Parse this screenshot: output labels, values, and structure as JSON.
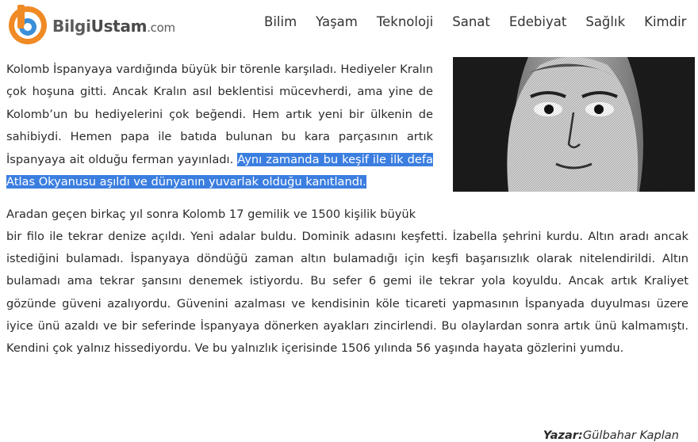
{
  "brand": {
    "part1": "Bilgi",
    "part2": "Ustam",
    "part3": ".com"
  },
  "nav": [
    "Bilim",
    "Yaşam",
    "Teknoloji",
    "Sanat",
    "Edebiyat",
    "Sağlık",
    "Kimdir"
  ],
  "article": {
    "p1_plain": "Kolomb İspanyaya vardığında büyük bir törenle karşıladı. Hediyeler Kralın çok hoşuna gitti. Ancak Kralın asıl beklentisi mücevherdi, ama yine de Kolomb’un bu hediyelerini çok beğendi. Hem artık yeni bir ülkenin de sahibiydi. Hemen papa ile batıda bulunan bu kara parçasının artık İspanyaya ait olduğu ferman yayınladı. ",
    "p1_selected": "Aynı zamanda bu keşif ile ilk defa Atlas Okyanusu aşıldı ve dünyanın yuvarlak olduğu kanıtlandı.",
    "p2_line1": "Aradan geçen birkaç yıl sonra Kolomb 17 gemilik ve 1500 kişilik büyük",
    "p2_rest": "bir filo ile tekrar denize açıldı. Yeni adalar buldu. Dominik adasını keşfetti. İzabella şehrini kurdu. Altın aradı ancak istediğini bulamadı. İspanyaya döndüğü zaman altın bulamadığı için keşfi başarısızlık olarak nitelendirildi. Altın bulamadı ama tekrar şansını denemek istiyordu. Bu sefer 6 gemi ile tekrar yola koyuldu. Ancak artık Kraliyet gözünde güveni azalıyordu. Güvenini azalması ve kendisinin köle ticareti yapmasının İspanyada duyulması üzere iyice ünü azaldı ve bir seferinde İspanyaya dönerken ayakları zincirlendi. Bu olaylardan sonra artık ünü kalmamıştı. Kendini çok yalnız hissediyordu. Ve bu yalnızlık içerisinde 1506 yılında 56 yaşında hayata gözlerini yumdu."
  },
  "author": {
    "label": "Yazar:",
    "name": "Gülbahar Kaplan"
  },
  "colors": {
    "selection": "#3b7ee0",
    "logo_orange": "#f08a24",
    "logo_blue": "#3a8fd8"
  }
}
